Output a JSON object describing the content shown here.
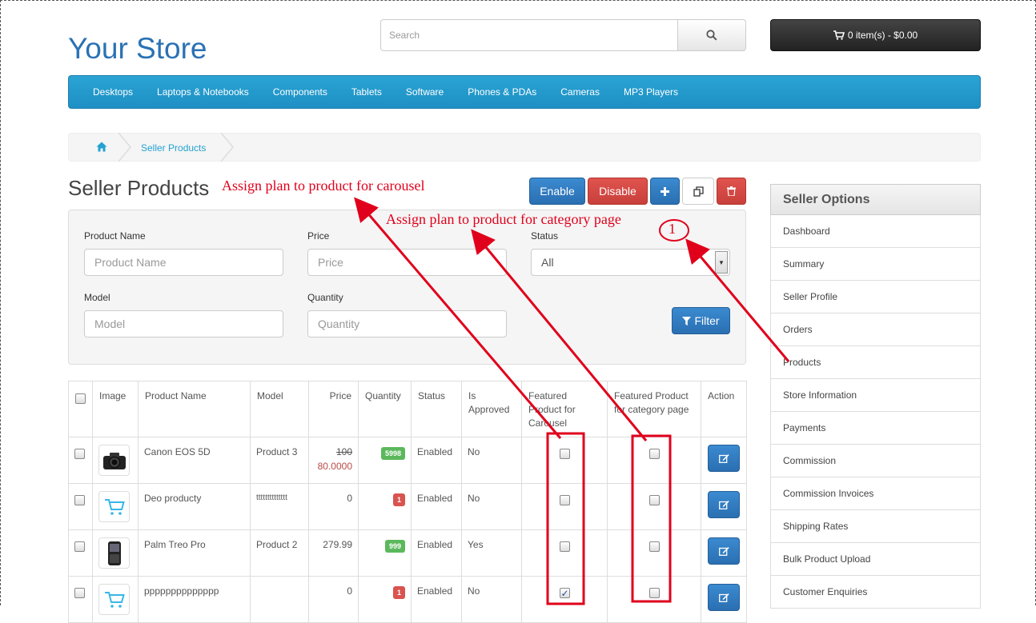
{
  "header": {
    "logo": "Your Store",
    "search_placeholder": "Search",
    "cart_label": "0 item(s) - $0.00"
  },
  "menu": [
    "Desktops",
    "Laptops & Notebooks",
    "Components",
    "Tablets",
    "Software",
    "Phones & PDAs",
    "Cameras",
    "MP3 Players"
  ],
  "breadcrumb": {
    "current": "Seller Products"
  },
  "page": {
    "title": "Seller Products",
    "buttons": {
      "enable": "Enable",
      "disable": "Disable"
    }
  },
  "filter": {
    "product_name_label": "Product Name",
    "product_name_placeholder": "Product Name",
    "price_label": "Price",
    "price_placeholder": "Price",
    "status_label": "Status",
    "status_value": "All",
    "model_label": "Model",
    "model_placeholder": "Model",
    "quantity_label": "Quantity",
    "quantity_placeholder": "Quantity",
    "filter_button": "Filter"
  },
  "table": {
    "headers": {
      "image": "Image",
      "product_name": "Product Name",
      "model": "Model",
      "price": "Price",
      "quantity": "Quantity",
      "status": "Status",
      "approved": "Is Approved",
      "featured_carousel": "Featured Product for Carousel",
      "featured_category": "Featured Product for category page",
      "action": "Action"
    },
    "rows": [
      {
        "name": "Canon EOS 5D",
        "model": "Product 3",
        "price_old": "100",
        "price": "80.0000",
        "quantity": "5998",
        "quantity_color": "green",
        "status": "Enabled",
        "approved": "No",
        "carousel": false,
        "category": false,
        "image": "camera-icon"
      },
      {
        "name": "Deo producty",
        "model": "tttttttttttttt",
        "price_old": "",
        "price": "0",
        "quantity": "1",
        "quantity_color": "red",
        "status": "Enabled",
        "approved": "No",
        "carousel": false,
        "category": false,
        "image": "cart-placeholder-icon"
      },
      {
        "name": "Palm Treo Pro",
        "model": "Product 2",
        "price_old": "",
        "price": "279.99",
        "quantity": "999",
        "quantity_color": "green",
        "status": "Enabled",
        "approved": "Yes",
        "carousel": false,
        "category": false,
        "image": "phone-icon"
      },
      {
        "name": "pppppppppppppp",
        "model": "",
        "price_old": "",
        "price": "0",
        "quantity": "1",
        "quantity_color": "red",
        "status": "Enabled",
        "approved": "No",
        "carousel": true,
        "category": false,
        "image": "cart-placeholder-icon"
      }
    ]
  },
  "sidebar": {
    "title": "Seller Options",
    "items": [
      "Dashboard",
      "Summary",
      "Seller Profile",
      "Orders",
      "Products",
      "Store Information",
      "Payments",
      "Commission",
      "Commission Invoices",
      "Shipping Rates",
      "Bulk Product Upload",
      "Customer Enquiries"
    ]
  },
  "annotations": {
    "carousel_note": "Assign plan to product for carousel",
    "category_note": "Assign plan to product for category page",
    "marker": "1"
  },
  "colors": {
    "brand": "#2a72b5",
    "menu": "#229ac8",
    "primary_button": "#2a6fb2",
    "danger_button": "#d9534f",
    "annotation": "#e0001b"
  }
}
